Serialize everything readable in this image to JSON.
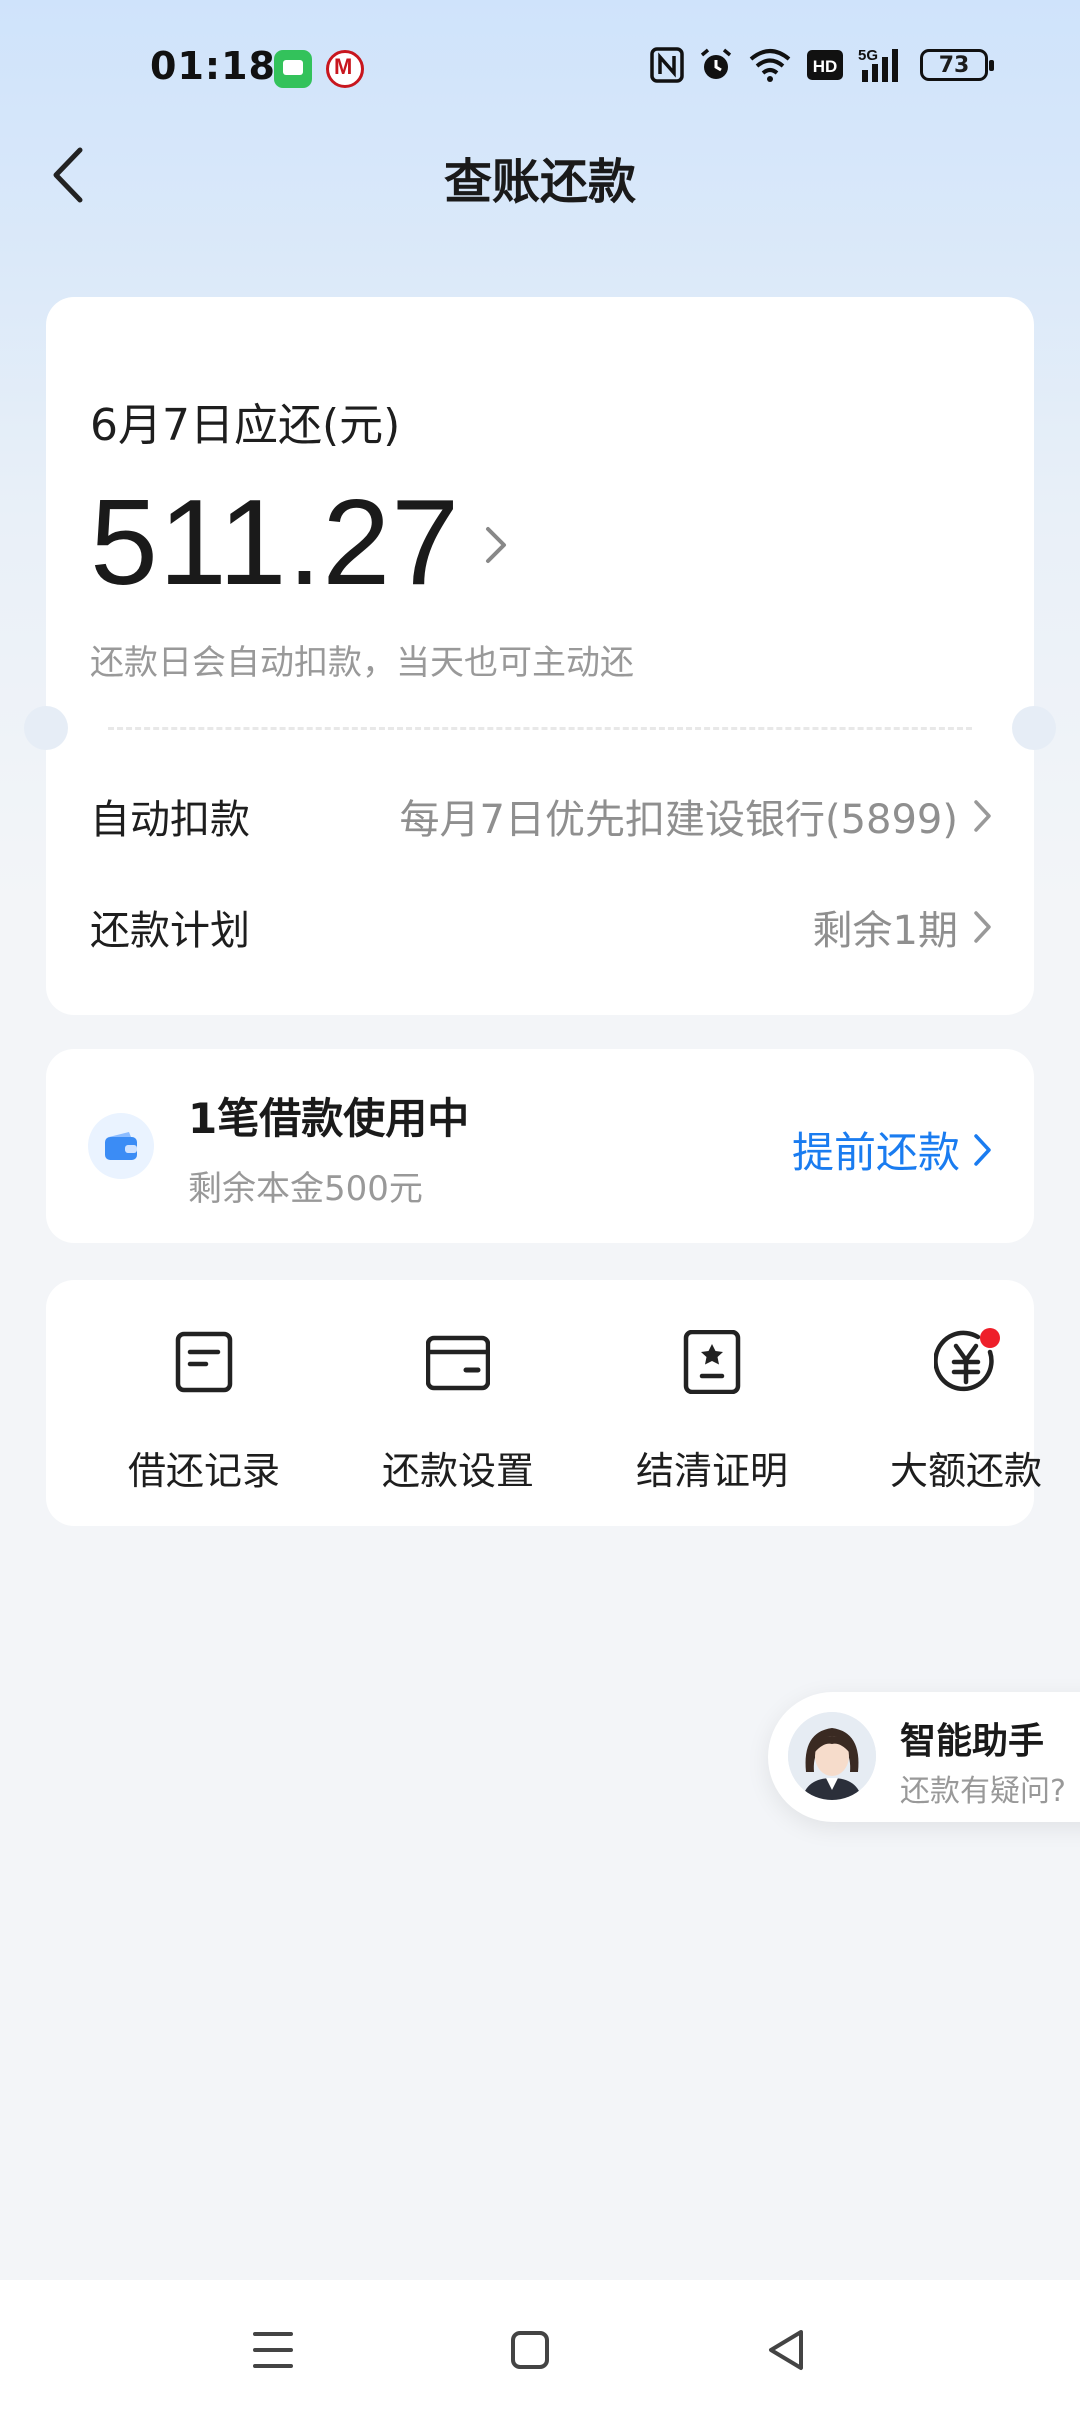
{
  "status_bar": {
    "time": "01:18",
    "battery": "73",
    "icons": [
      "messages-app-icon",
      "bank-app-icon",
      "nfc-icon",
      "alarm-icon",
      "wifi-icon",
      "hd-icon",
      "5g-signal-icon",
      "battery-icon"
    ]
  },
  "header": {
    "title": "查账还款",
    "back_icon": "chevron-left-icon"
  },
  "bill": {
    "due_label": "6月7日应还(元)",
    "amount": "511.27",
    "note": "还款日会自动扣款，当天也可主动还",
    "rows": [
      {
        "label": "自动扣款",
        "value": "每月7日优先扣建设银行(5899)"
      },
      {
        "label": "还款计划",
        "value": "剩余1期"
      }
    ]
  },
  "loan": {
    "title": "1笔借款使用中",
    "subtitle": "剩余本金500元",
    "action": "提前还款",
    "icon": "wallet-icon"
  },
  "tools": [
    {
      "label": "借还记录",
      "icon": "record-icon"
    },
    {
      "label": "还款设置",
      "icon": "card-icon"
    },
    {
      "label": "结清证明",
      "icon": "certificate-icon"
    },
    {
      "label": "大额还款",
      "icon": "yuan-icon"
    }
  ],
  "assistant": {
    "title": "智能助手",
    "subtitle": "还款有疑问?"
  },
  "colors": {
    "accent": "#1a7cf0",
    "badge_red": "#ee1f2a",
    "text_muted": "#999999"
  }
}
